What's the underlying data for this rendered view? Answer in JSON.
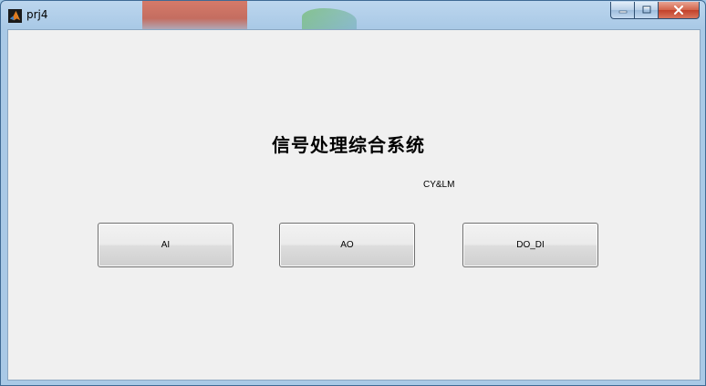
{
  "window": {
    "title": "prj4",
    "controls": {
      "minimize_icon": "minimize-icon",
      "maximize_icon": "maximize-icon",
      "close_icon": "close-icon"
    }
  },
  "main": {
    "heading": "信号处理综合系统",
    "subtitle": "CY&LM",
    "buttons": [
      {
        "label": "AI"
      },
      {
        "label": "AO"
      },
      {
        "label": "DO_DI"
      }
    ]
  },
  "colors": {
    "client_bg": "#f0f0f0",
    "titlebar": "#a9c9e6",
    "close_button": "#c2412a"
  }
}
